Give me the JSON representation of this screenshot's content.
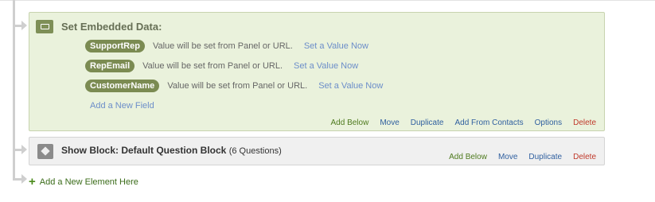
{
  "embedded_data": {
    "title": "Set Embedded Data:",
    "fields": [
      {
        "name": "SupportRep",
        "description": "Value will be set from Panel or URL.",
        "link": "Set a Value Now"
      },
      {
        "name": "RepEmail",
        "description": "Value will be set from Panel or URL.",
        "link": "Set a Value Now"
      },
      {
        "name": "CustomerName",
        "description": "Value will be set from Panel or URL.",
        "link": "Set a Value Now"
      }
    ],
    "add_field": "Add a New Field",
    "actions": {
      "add_below": "Add Below",
      "move": "Move",
      "duplicate": "Duplicate",
      "add_from_contacts": "Add From Contacts",
      "options": "Options",
      "delete": "Delete"
    }
  },
  "show_block": {
    "title": "Show Block: Default Question Block",
    "count": "(6 Questions)",
    "actions": {
      "add_below": "Add Below",
      "move": "Move",
      "duplicate": "Duplicate",
      "delete": "Delete"
    }
  },
  "add_element": {
    "plus": "+",
    "label": "Add a New Element Here"
  },
  "colors": {
    "embedded_bg": "#eaf2dc",
    "pill": "#7b8b52",
    "link_blue": "#6c8ec9",
    "action_green": "#4e7a1e",
    "action_blue": "#2f5f9f",
    "action_red": "#c0392b"
  },
  "icons": {
    "embedded_data": "embedded-data-icon",
    "show_block": "block-cube-icon"
  }
}
